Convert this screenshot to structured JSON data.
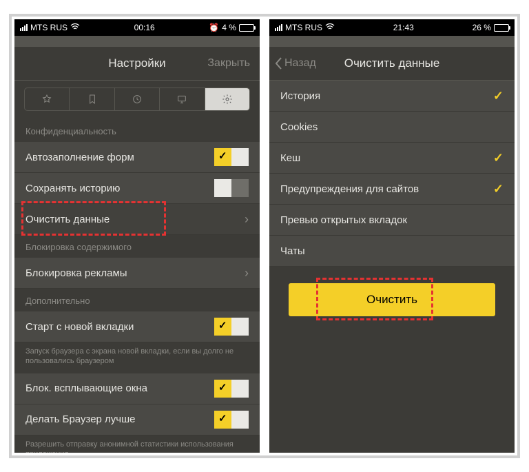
{
  "left": {
    "status": {
      "carrier": "MTS RUS",
      "time": "00:16",
      "batt_text": "4 %",
      "alarm": "⏰",
      "batt_pct": 5
    },
    "nav": {
      "title": "Настройки",
      "close": "Закрыть"
    },
    "section1": "Конфиденциальность",
    "rows1": {
      "autofill": "Автозаполнение форм",
      "savehist": "Сохранять историю",
      "cleardata": "Очистить данные"
    },
    "section2": "Блокировка содержимого",
    "adblock": "Блокировка рекламы",
    "section3": "Дополнительно",
    "startnew": "Старт с новой вкладки",
    "startnew_hint": "Запуск браузера с экрана новой вкладки, если вы долго не пользовались браузером",
    "blockpop": "Блок. всплывающие окна",
    "improve": "Делать Браузер лучше",
    "improve_hint": "Разрешить отправку анонимной статистики использования приложения"
  },
  "right": {
    "status": {
      "carrier": "MTS RUS",
      "time": "21:43",
      "batt_text": "26 %",
      "batt_pct": 26
    },
    "nav": {
      "back": "Назад",
      "title": "Очистить данные"
    },
    "items": {
      "history": "История",
      "cookies": "Cookies",
      "cache": "Кеш",
      "sitewarn": "Предупреждения для сайтов",
      "preview": "Превью открытых вкладок",
      "chats": "Чаты"
    },
    "button": "Очистить"
  }
}
